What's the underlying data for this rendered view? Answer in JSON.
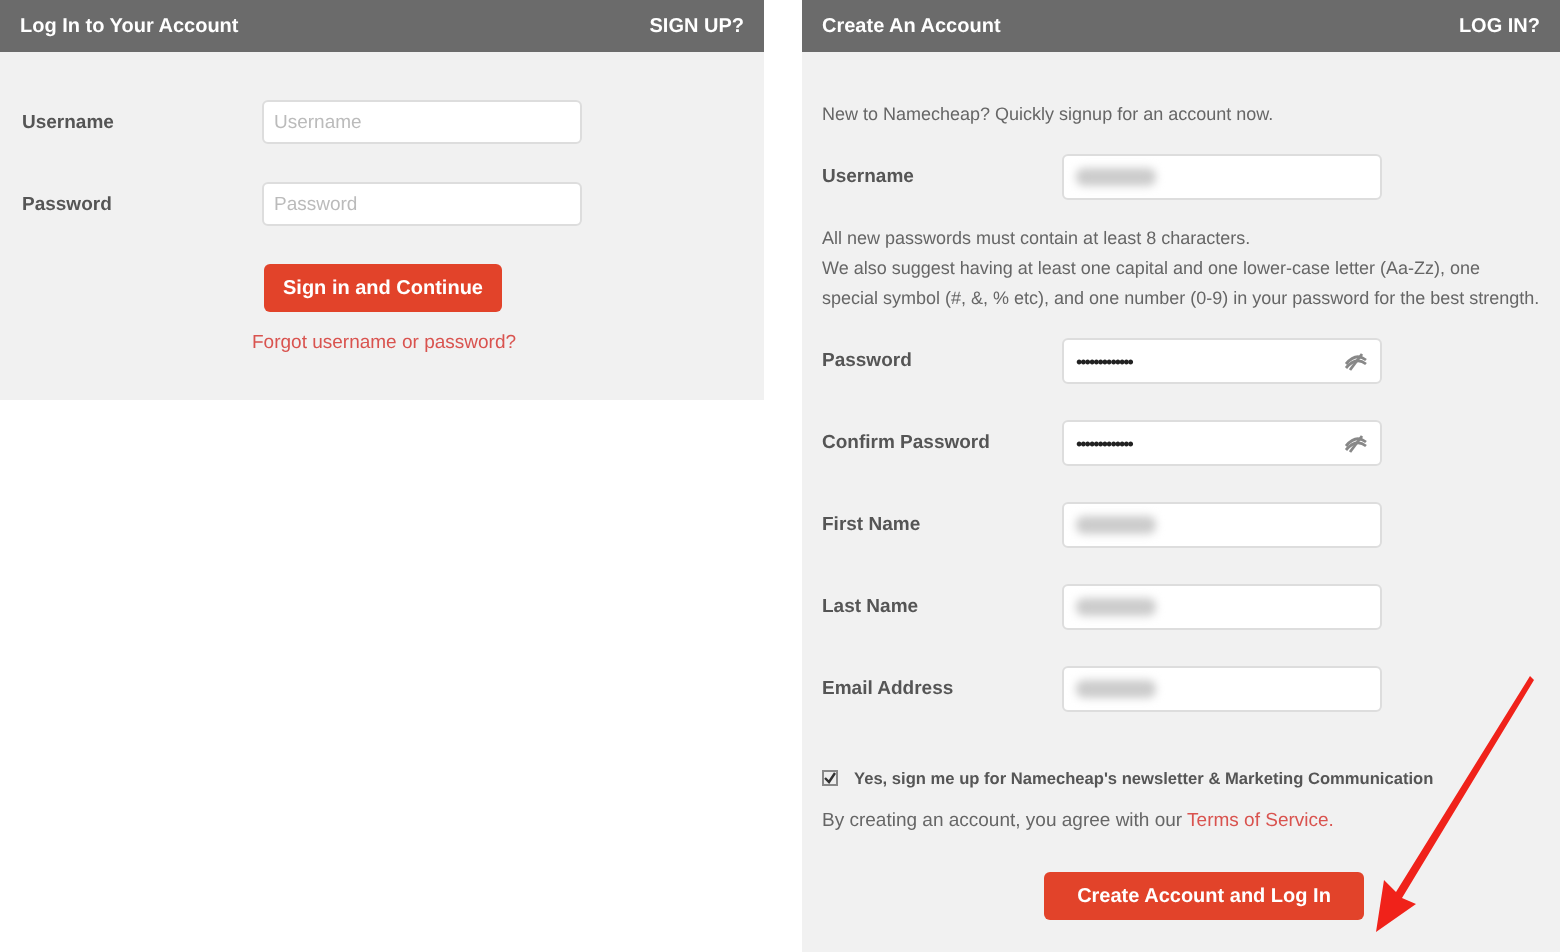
{
  "login": {
    "title": "Log In to Your Account",
    "switch_link": "SIGN UP?",
    "fields": [
      {
        "label": "Username",
        "placeholder": "Username"
      },
      {
        "label": "Password",
        "placeholder": "Password"
      }
    ],
    "button": "Sign in and Continue",
    "forgot_link": "Forgot username or password?"
  },
  "signup": {
    "title": "Create An Account",
    "switch_link": "LOG IN?",
    "items": [
      {
        "kind": "note",
        "lines": [
          "New to Namecheap? Quickly signup for an account now."
        ]
      },
      {
        "kind": "blurred_field",
        "label": "Username"
      },
      {
        "kind": "note",
        "lines": [
          "All new passwords must contain at least 8 characters.",
          "We also suggest having at least one capital and one lower-case letter (Aa-Zz), one special symbol (#, &, % etc), and one number (0-9) in your password for the best strength."
        ]
      },
      {
        "kind": "password_field",
        "label": "Password",
        "value": "•••••••••••••"
      },
      {
        "kind": "password_field",
        "label": "Confirm Password",
        "value": "•••••••••••••"
      },
      {
        "kind": "blurred_field",
        "label": "First Name"
      },
      {
        "kind": "blurred_field",
        "label": "Last Name"
      },
      {
        "kind": "blurred_field",
        "label": "Email Address"
      }
    ],
    "newsletter": {
      "label": "Yes, sign me up for Namecheap's newsletter & Marketing Communication",
      "checked": true
    },
    "terms": {
      "text": "By creating an account, you agree with our",
      "link": "Terms of Service."
    },
    "button": "Create Account and Log In"
  }
}
